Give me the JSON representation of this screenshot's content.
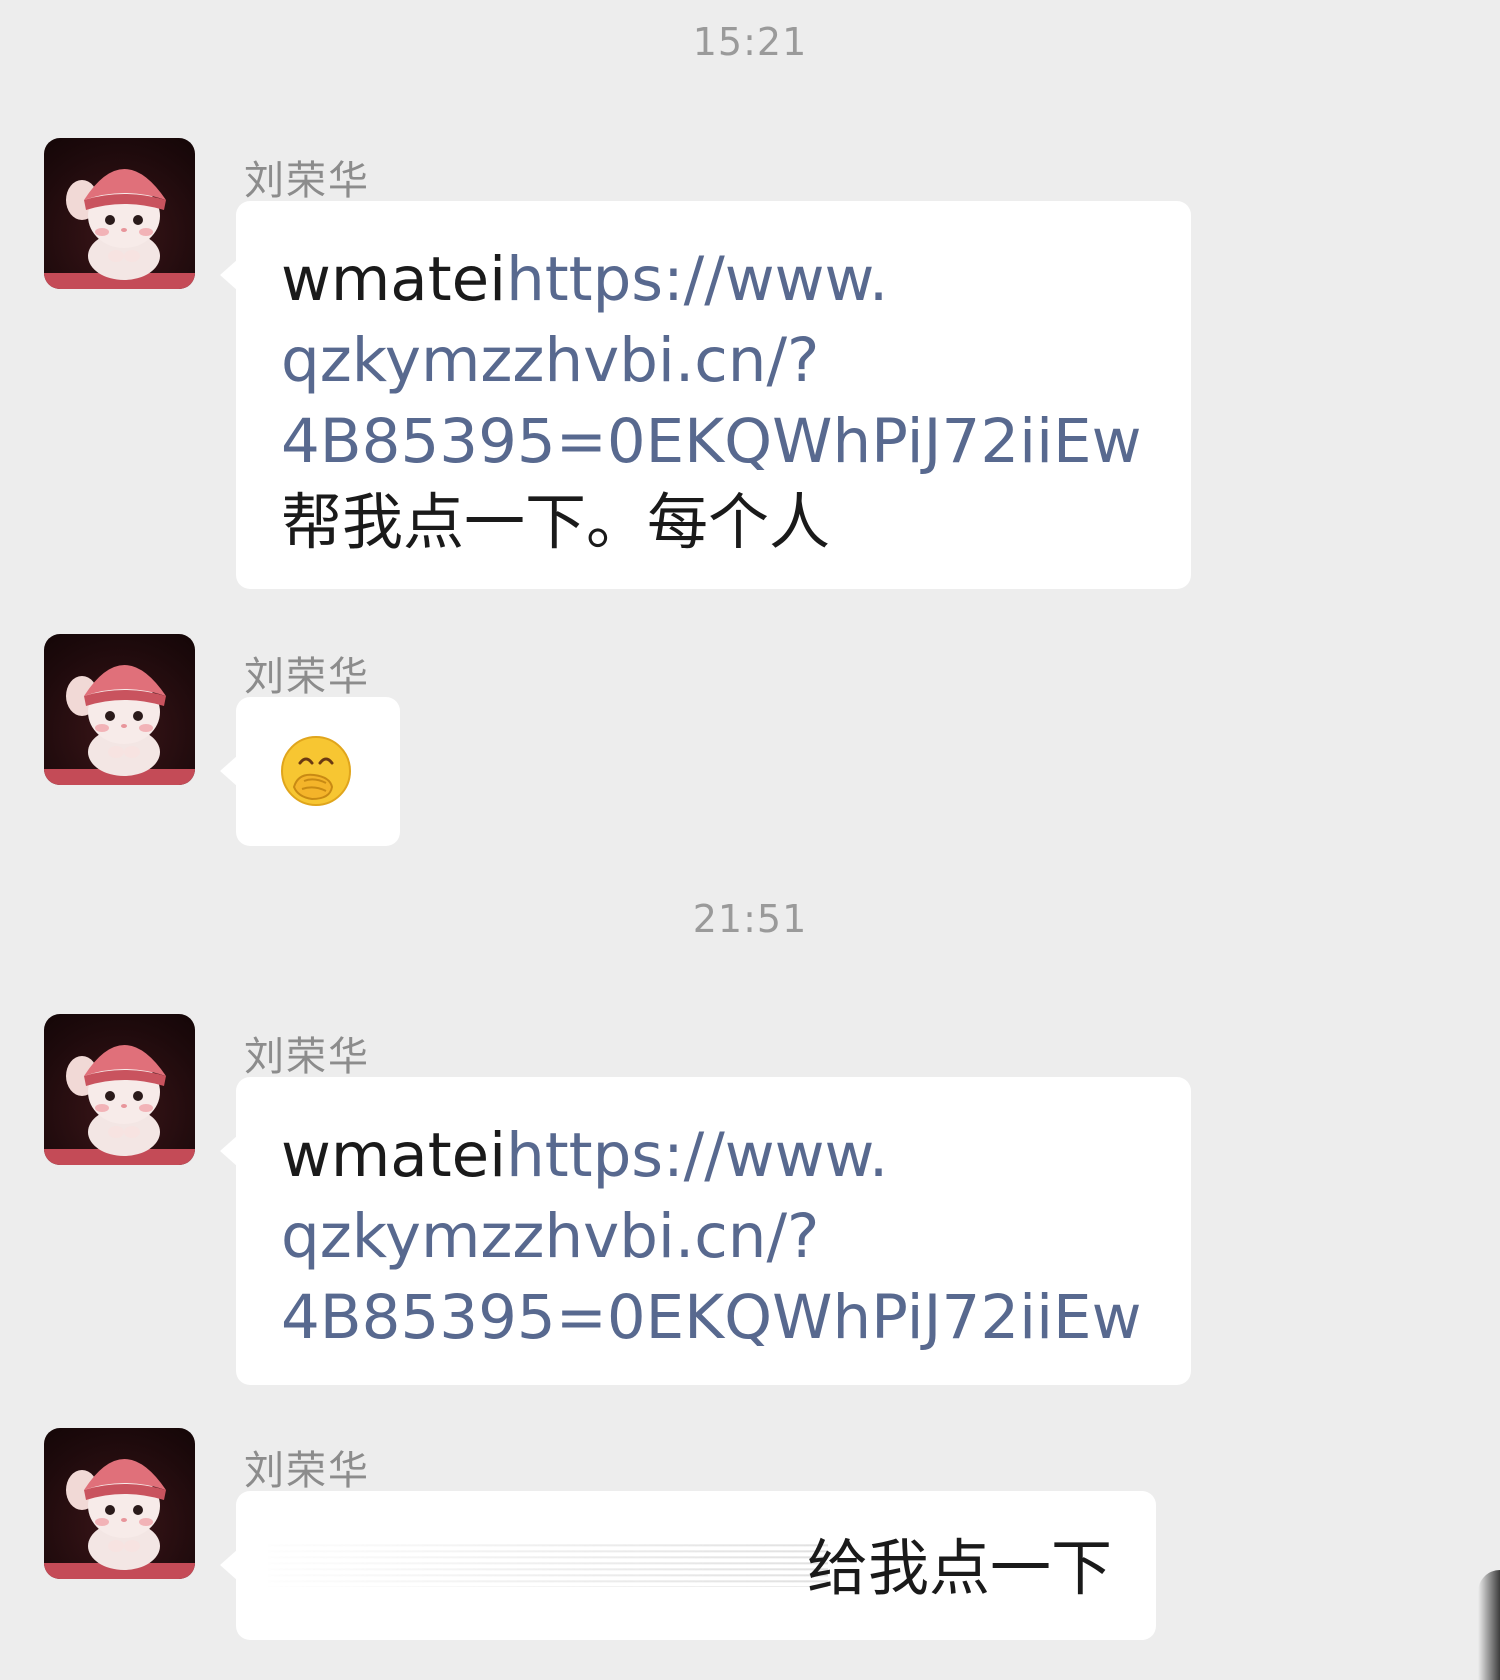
{
  "chat": {
    "timestamps": [
      "15:21",
      "21:51"
    ],
    "messages": [
      {
        "sender": "刘荣华",
        "avatar_icon": "bunny-knit-hat-avatar",
        "prefix": "wmatei",
        "link_lines": [
          "https://www.",
          "qzkymzzhvbi.cn/?",
          "4B85395=0EKQWhPiJ72iiEw"
        ],
        "suffix": "帮我点一下。每个人"
      },
      {
        "sender": "刘荣华",
        "avatar_icon": "bunny-knit-hat-avatar",
        "emoji": "covering-mouth-smile-emoji"
      },
      {
        "sender": "刘荣华",
        "avatar_icon": "bunny-knit-hat-avatar",
        "prefix": "wmatei",
        "link_lines": [
          "https://www.",
          "qzkymzzhvbi.cn/?",
          "4B85395=0EKQWhPiJ72iiEw"
        ]
      },
      {
        "sender": "刘荣华",
        "avatar_icon": "bunny-knit-hat-avatar",
        "visible_text": "给我点一下"
      }
    ]
  },
  "colors": {
    "background": "#ededed",
    "bubble": "#ffffff",
    "link": "#58698f",
    "timestamp": "#9a9a9a",
    "sender": "#8c8c8c"
  }
}
